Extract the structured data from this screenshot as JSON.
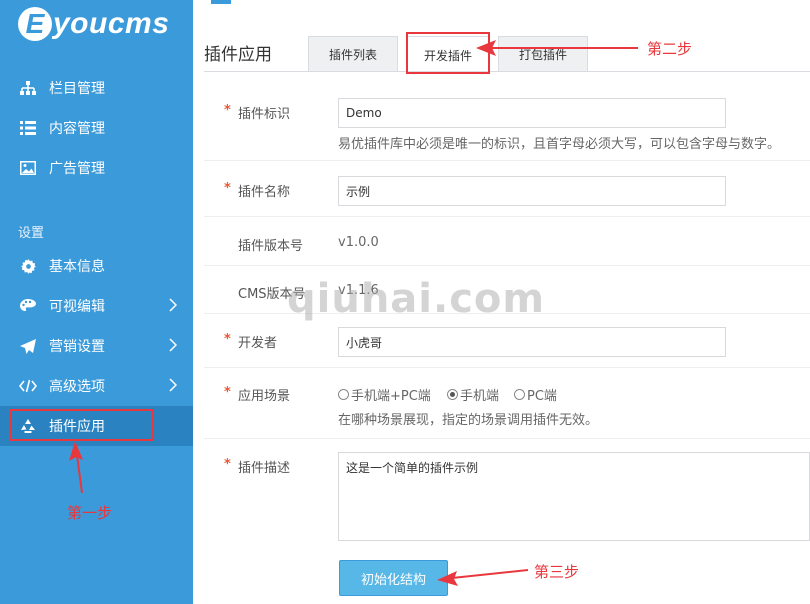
{
  "sidebar": {
    "logo_letter": "E",
    "logo_text": "youcms",
    "items": [
      {
        "label": "栏目管理",
        "icon": "sitemap-icon"
      },
      {
        "label": "内容管理",
        "icon": "list-icon"
      },
      {
        "label": "广告管理",
        "icon": "image-icon"
      }
    ],
    "section_label": "设置",
    "settings_items": [
      {
        "label": "基本信息",
        "icon": "gear-icon"
      },
      {
        "label": "可视编辑",
        "icon": "palette-icon"
      },
      {
        "label": "营销设置",
        "icon": "send-icon"
      },
      {
        "label": "高级选项",
        "icon": "code-icon"
      },
      {
        "label": "插件应用",
        "icon": "recycle-icon",
        "active": true
      }
    ]
  },
  "header": {
    "title": "插件应用",
    "tabs": [
      {
        "label": "插件列表"
      },
      {
        "label": "开发插件",
        "active": true
      },
      {
        "label": "打包插件"
      }
    ]
  },
  "form": {
    "plugin_id": {
      "label": "插件标识",
      "value": "Demo",
      "hint": "易优插件库中必须是唯一的标识，且首字母必须大写，可以包含字母与数字。"
    },
    "plugin_name": {
      "label": "插件名称",
      "value": "示例"
    },
    "plugin_version": {
      "label": "插件版本号",
      "value": "v1.0.0"
    },
    "cms_version": {
      "label": "CMS版本号",
      "value": "v1.1.6"
    },
    "developer": {
      "label": "开发者",
      "value": "小虎哥"
    },
    "scene": {
      "label": "应用场景",
      "options": [
        "手机端+PC端",
        "手机端",
        "PC端"
      ],
      "selected": "手机端",
      "hint": "在哪种场景展现，指定的场景调用插件无效。"
    },
    "description": {
      "label": "插件描述",
      "value": "这是一个简单的插件示例"
    },
    "submit_label": "初始化结构"
  },
  "annotations": {
    "step1": "第一步",
    "step2": "第二步",
    "step3": "第三步",
    "watermark": "qiuhai.com",
    "color": "#e8383d"
  },
  "colors": {
    "sidebar_bg": "#3b9ad9",
    "sidebar_active": "#2a82c0",
    "button_bg": "#57b8e8",
    "required_star": "#e8572f"
  }
}
